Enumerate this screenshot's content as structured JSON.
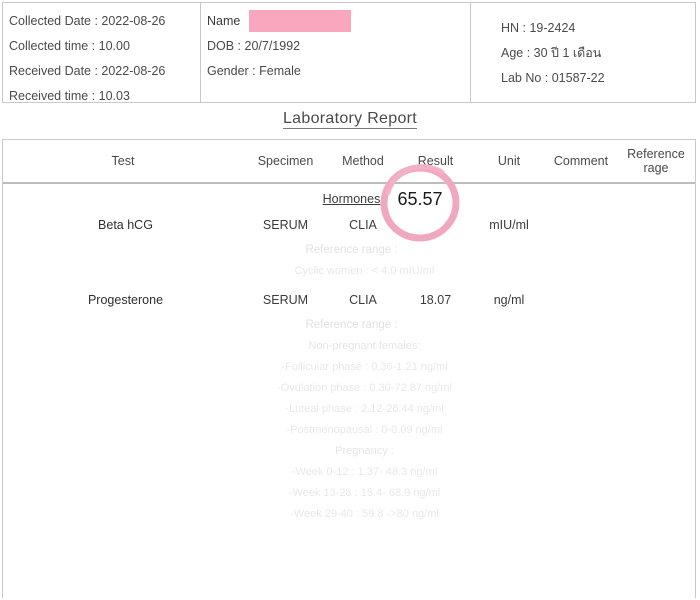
{
  "header": {
    "collected": [
      "Collected Date : 2022-08-26",
      "Collected time : 10.00",
      "Received Date : 2022-08-26",
      "Received time : 10.03"
    ],
    "patient": {
      "name_label": "Name",
      "name_value_redacted": "",
      "dob": "DOB : 20/7/1992",
      "gender": "Gender : Female"
    },
    "ids": {
      "hn": "HN : 19-2424",
      "age": "Age : 30 ปี 1 เดือน",
      "lab_no": "Lab No : 01587-22"
    }
  },
  "title": "Laboratory Report",
  "table": {
    "columns": [
      "Test",
      "Specimen",
      "Method",
      "Result",
      "Unit",
      "Comment",
      "Reference rage"
    ],
    "section": "Hormones",
    "rows": [
      {
        "test": "Beta hCG",
        "specimen": "SERUM",
        "method": "CLIA",
        "result": "65.57",
        "unit": "mIU/ml",
        "comment": "",
        "reference": "",
        "ref_title": "Reference range :",
        "ref_lines": [
          "Cyclic women : < 4.0 mIU/ml"
        ]
      },
      {
        "test": "Progesterone",
        "specimen": "SERUM",
        "method": "CLIA",
        "result": "18.07",
        "unit": "ng/ml",
        "comment": "",
        "reference": "",
        "ref_title": "Reference range :",
        "ref_lines": [
          "Non-pregnant females:",
          "-Follicular phase : 0.36-1.21 ng/ml",
          "-Ovulation phase : 0.30-72.87 ng/ml",
          "-Luteal phase : 2.12-26.44 ng/ml",
          "-Postmenopausal : 0-0.09 ng/ml",
          "Pregnancy :",
          "-Week 0-12 : 1.37- 48.3 ng/ml",
          "-Week 13-28 : 15.4- 68.9 ng/ml",
          "-Week 29-40 : 59.8 ->80 ng/ml"
        ]
      }
    ]
  },
  "annotation": {
    "circled_value": "65.57",
    "ring_color": "#f0a8c0",
    "redaction_color": "#f9a7bf"
  }
}
